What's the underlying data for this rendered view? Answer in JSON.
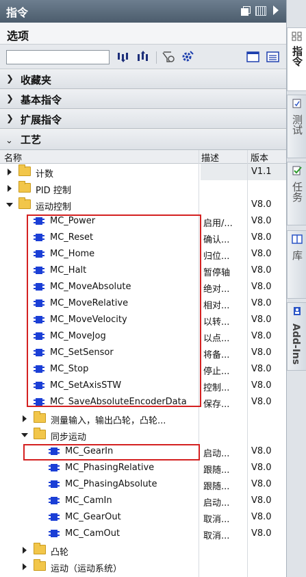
{
  "panel": {
    "title": "指令"
  },
  "options": {
    "title": "选项"
  },
  "search": {
    "value": "",
    "placeholder": ""
  },
  "sections": [
    {
      "label": "收藏夹",
      "expanded": false
    },
    {
      "label": "基本指令",
      "expanded": false
    },
    {
      "label": "扩展指令",
      "expanded": false
    },
    {
      "label": "工艺",
      "expanded": true
    }
  ],
  "columns": {
    "name": "名称",
    "description": "描述",
    "version": "版本"
  },
  "tree": {
    "jishu": {
      "name": "计数",
      "desc": "",
      "ver": "V1.1"
    },
    "pid": {
      "name": "PID 控制",
      "desc": "",
      "ver": ""
    },
    "motion": {
      "name": "运动控制",
      "desc": "",
      "ver": "V8.0"
    },
    "mc_power": {
      "name": "MC_Power",
      "desc": "启用/...",
      "ver": "V8.0"
    },
    "mc_reset": {
      "name": "MC_Reset",
      "desc": "确认...",
      "ver": "V8.0"
    },
    "mc_home": {
      "name": "MC_Home",
      "desc": "归位...",
      "ver": "V8.0"
    },
    "mc_halt": {
      "name": "MC_Halt",
      "desc": "暂停轴",
      "ver": "V8.0"
    },
    "mc_moveabsolute": {
      "name": "MC_MoveAbsolute",
      "desc": "绝对...",
      "ver": "V8.0"
    },
    "mc_moverelative": {
      "name": "MC_MoveRelative",
      "desc": "相对...",
      "ver": "V8.0"
    },
    "mc_movevelocity": {
      "name": "MC_MoveVelocity",
      "desc": "以转...",
      "ver": "V8.0"
    },
    "mc_movejog": {
      "name": "MC_MoveJog",
      "desc": "以点...",
      "ver": "V8.0"
    },
    "mc_setsensor": {
      "name": "MC_SetSensor",
      "desc": "将备...",
      "ver": "V8.0"
    },
    "mc_stop": {
      "name": "MC_Stop",
      "desc": "停止...",
      "ver": "V8.0"
    },
    "mc_setaxisstw": {
      "name": "MC_SetAxisSTW",
      "desc": "控制...",
      "ver": "V8.0"
    },
    "mc_saveabs": {
      "name": "MC_SaveAbsoluteEncoderData",
      "desc": "保存...",
      "ver": "V8.0"
    },
    "measure": {
      "name": "测量输入，输出凸轮，凸轮...",
      "desc": "",
      "ver": ""
    },
    "sync": {
      "name": "同步运动",
      "desc": "",
      "ver": ""
    },
    "mc_gearin": {
      "name": "MC_GearIn",
      "desc": "启动...",
      "ver": "V8.0"
    },
    "mc_phasingrelative": {
      "name": "MC_PhasingRelative",
      "desc": "跟随...",
      "ver": "V8.0"
    },
    "mc_phasingabsolute": {
      "name": "MC_PhasingAbsolute",
      "desc": "跟随...",
      "ver": "V8.0"
    },
    "mc_camin": {
      "name": "MC_CamIn",
      "desc": "启动...",
      "ver": "V8.0"
    },
    "mc_gearout": {
      "name": "MC_GearOut",
      "desc": "取消...",
      "ver": "V8.0"
    },
    "mc_camout": {
      "name": "MC_CamOut",
      "desc": "取消...",
      "ver": "V8.0"
    },
    "cam": {
      "name": "凸轮",
      "desc": "",
      "ver": ""
    },
    "motion_system": {
      "name": "运动（运动系统）",
      "desc": "",
      "ver": ""
    }
  },
  "side_tabs": [
    {
      "label": "指令",
      "active": true
    },
    {
      "label": "测试",
      "active": false
    },
    {
      "label": "任务",
      "active": false
    },
    {
      "label": "库",
      "active": false
    },
    {
      "label": "Add-Ins",
      "active": false
    }
  ],
  "highlight_color": "#d42020"
}
